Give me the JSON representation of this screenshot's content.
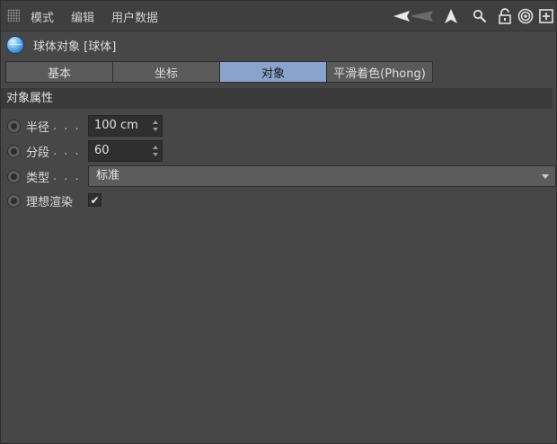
{
  "menu": {
    "items": [
      {
        "label": "模式"
      },
      {
        "label": "编辑"
      },
      {
        "label": "用户数据"
      }
    ],
    "tools": [
      "back-arrow-icon",
      "up-arrow-icon",
      "search-icon",
      "lock-icon",
      "target-icon",
      "new-panel-icon"
    ]
  },
  "object": {
    "title": "球体对象 [球体]"
  },
  "tabs": [
    {
      "label": "基本",
      "active": false
    },
    {
      "label": "坐标",
      "active": false
    },
    {
      "label": "对象",
      "active": true
    },
    {
      "label": "平滑着色(Phong)",
      "active": false
    }
  ],
  "section": {
    "title": "对象属性"
  },
  "params": {
    "radius": {
      "label": "半径",
      "dots": ". . .",
      "value": "100 cm"
    },
    "segments": {
      "label": "分段",
      "dots": ". . .",
      "value": "60"
    },
    "type": {
      "label": "类型",
      "dots": ". . .",
      "value": "标准"
    },
    "render": {
      "label": "理想渲染",
      "checked": true,
      "check_glyph": "✔"
    }
  },
  "colors": {
    "background": "#474747",
    "active_tab": "#8aa3cc",
    "field_bg": "#2f2f2f"
  }
}
